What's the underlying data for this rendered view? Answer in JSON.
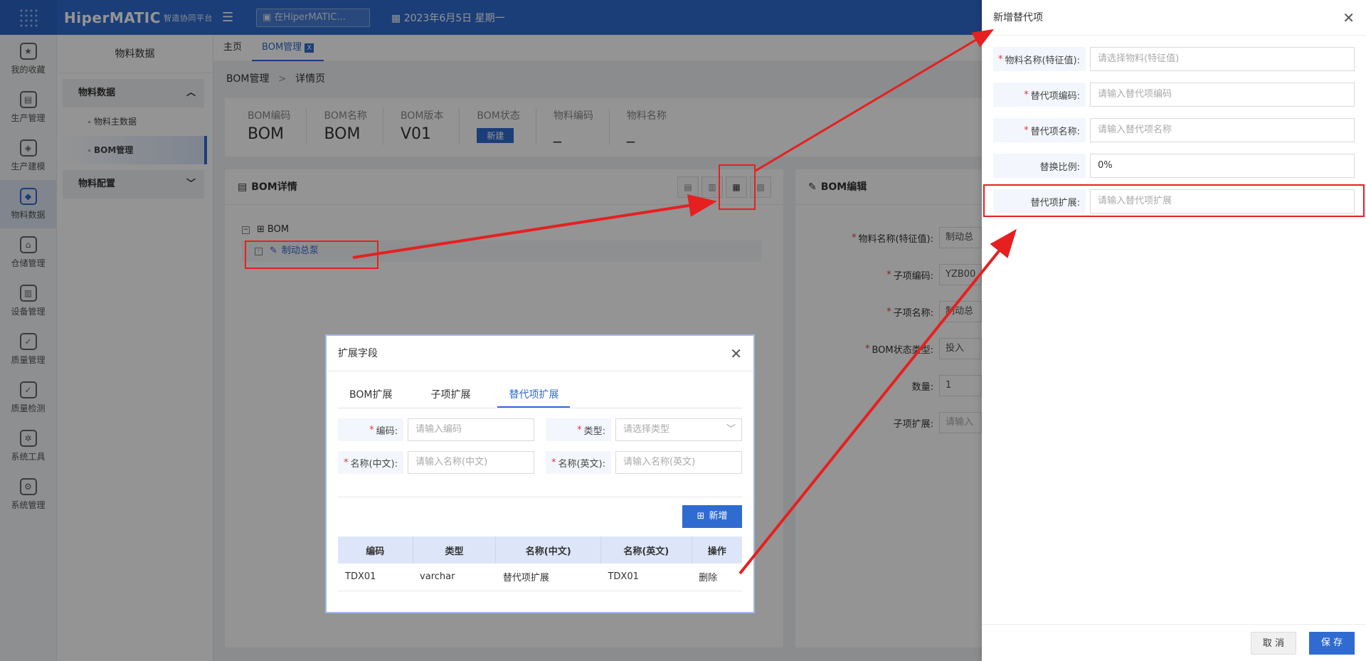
{
  "header": {
    "brand": "HiperMATIC",
    "brand_sub": "智造协同平台",
    "search_placeholder": "在HiperMATIC...",
    "date": "2023年6月5日 星期一"
  },
  "leftnav": [
    {
      "label": "我的收藏",
      "icon": "star-icon"
    },
    {
      "label": "生产管理",
      "icon": "production-icon"
    },
    {
      "label": "生产建模",
      "icon": "cube-icon"
    },
    {
      "label": "物料数据",
      "icon": "material-icon",
      "active": true
    },
    {
      "label": "仓储管理",
      "icon": "warehouse-icon"
    },
    {
      "label": "设备管理",
      "icon": "device-icon"
    },
    {
      "label": "质量管理",
      "icon": "shield-icon"
    },
    {
      "label": "质量检测",
      "icon": "inspect-icon"
    },
    {
      "label": "系统工具",
      "icon": "tools-icon"
    },
    {
      "label": "系统管理",
      "icon": "settings-icon"
    }
  ],
  "submenu": {
    "title": "物料数据",
    "group1": "物料数据",
    "items": [
      "物料主数据",
      "BOM管理"
    ],
    "group2": "物料配置"
  },
  "tabs": {
    "home": "主页",
    "bom": "BOM管理",
    "close": "X"
  },
  "breadcrumb": {
    "parent": "BOM管理",
    "sep": ">",
    "current": "详情页"
  },
  "info": [
    {
      "label": "BOM编码",
      "value": "BOM"
    },
    {
      "label": "BOM名称",
      "value": "BOM"
    },
    {
      "label": "BOM版本",
      "value": "V01"
    },
    {
      "label": "BOM状态",
      "value": "新建"
    },
    {
      "label": "物料编码",
      "value": "_"
    },
    {
      "label": "物料名称",
      "value": "_"
    }
  ],
  "bom_detail": {
    "title": "BOM详情",
    "root": "BOM",
    "child": "制动总泵"
  },
  "bom_edit": {
    "title": "BOM编辑",
    "fields": [
      {
        "label": "物料名称(特征值):",
        "value": "制动总",
        "required": true
      },
      {
        "label": "子项编码:",
        "value": "YZB00",
        "required": true
      },
      {
        "label": "子项名称:",
        "value": "制动总",
        "required": true
      },
      {
        "label": "BOM状态类型:",
        "value": "投入",
        "required": true
      },
      {
        "label": "数量:",
        "value": "1",
        "required": false
      },
      {
        "label": "子项扩展:",
        "value": "请输入",
        "required": false
      }
    ]
  },
  "modal": {
    "title": "扩展字段",
    "tabs": [
      "BOM扩展",
      "子项扩展",
      "替代项扩展"
    ],
    "fields": {
      "code_label": "编码:",
      "code_ph": "请输入编码",
      "type_label": "类型:",
      "type_ph": "请选择类型",
      "name_cn_label": "名称(中文):",
      "name_cn_ph": "请输入名称(中文)",
      "name_en_label": "名称(英文):",
      "name_en_ph": "请输入名称(英文)"
    },
    "add_label": "新增",
    "columns": [
      "编码",
      "类型",
      "名称(中文)",
      "名称(英文)",
      "操作"
    ],
    "rows": [
      {
        "code": "TDX01",
        "type": "varchar",
        "name_cn": "替代项扩展",
        "name_en": "TDX01",
        "action": "删除"
      }
    ]
  },
  "drawer": {
    "title": "新增替代项",
    "fields": [
      {
        "label": "物料名称(特征值):",
        "placeholder": "请选择物料(特征值)",
        "required": true
      },
      {
        "label": "替代项编码:",
        "placeholder": "请输入替代项编码",
        "required": true
      },
      {
        "label": "替代项名称:",
        "placeholder": "请输入替代项名称",
        "required": true
      },
      {
        "label": "替换比例:",
        "value": "0%",
        "required": false
      },
      {
        "label": "替代项扩展:",
        "placeholder": "请输入替代项扩展",
        "required": false
      }
    ],
    "cancel": "取 消",
    "save": "保 存"
  },
  "colors": {
    "primary": "#2f6bd1",
    "annotation": "#e62020",
    "danger": "#e0475a"
  }
}
